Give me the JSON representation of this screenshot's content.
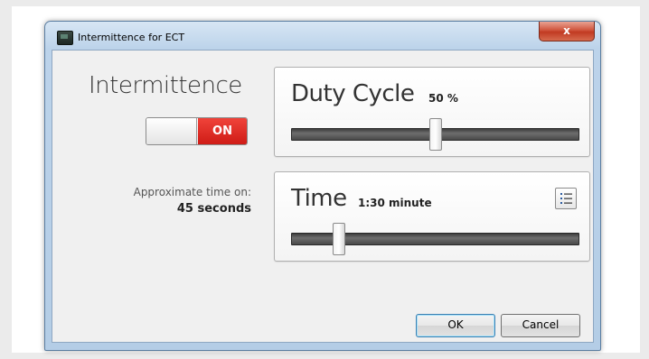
{
  "window": {
    "title": "Intermittence for ECT",
    "close_label": "x"
  },
  "intermittence": {
    "label": "Intermittence",
    "toggle_state": "ON"
  },
  "approx": {
    "label": "Approximate time on:",
    "value": "45 seconds"
  },
  "duty_cycle": {
    "title": "Duty Cycle",
    "value": "50 %",
    "level": 0.5
  },
  "time": {
    "title": "Time",
    "value": "1:30 minute",
    "level": 0.15
  },
  "buttons": {
    "ok": "OK",
    "cancel": "Cancel"
  },
  "icons": {
    "app": "app-icon",
    "list": "list-icon",
    "close": "close-icon"
  }
}
